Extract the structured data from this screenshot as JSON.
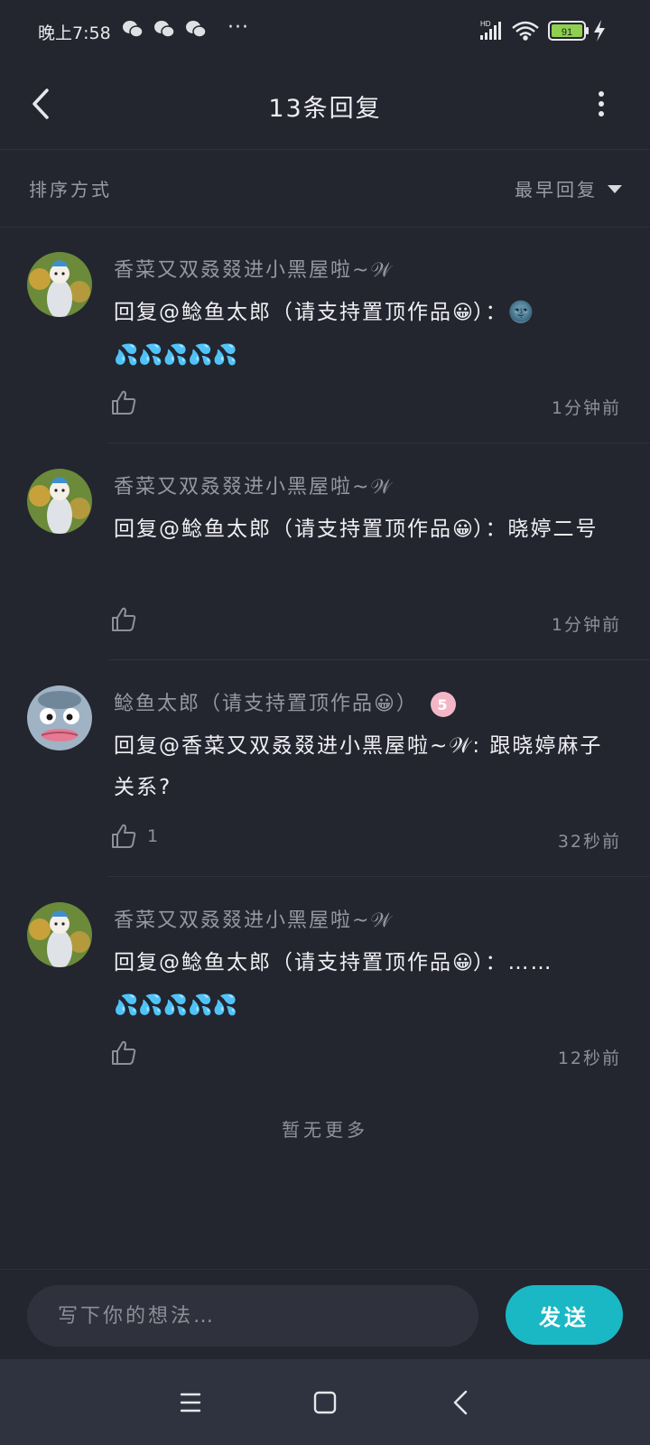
{
  "status_bar": {
    "time": "晚上7:58",
    "dots": "···",
    "network": "HD",
    "battery": "91",
    "icons": [
      "wechat-icon",
      "wechat-icon",
      "wechat-icon",
      "signal-icon",
      "wifi-icon",
      "battery-icon",
      "charging-icon"
    ]
  },
  "header": {
    "title": "13条回复",
    "icons": [
      "back-arrow-icon",
      "more-vertical-icon"
    ]
  },
  "sort": {
    "label": "排序方式",
    "selected": "最早回复",
    "icon": "caret-down-icon"
  },
  "comments": [
    {
      "user": "香菜又双叒叕进小黑屋啦~𝒲",
      "prefix": "回复@鲶鱼太郎（请支持置顶作品",
      "emoji": "😀",
      "suffix": "）：🌚",
      "extra": "💦💦💦💦💦",
      "likes": "",
      "time": "1分钟前"
    },
    {
      "user": "香菜又双叒叕进小黑屋啦~𝒲",
      "prefix": "回复@鲶鱼太郎（请支持置顶作品",
      "emoji": "😀",
      "suffix": "）：晓婷二号",
      "extra": "",
      "likes": "",
      "time": "1分钟前"
    },
    {
      "user": "鲶鱼太郎（请支持置顶作品😀）",
      "badge": "5",
      "prefix": "回复@香菜又双叒叕进小黑屋啦~𝒲: 跟晓婷麻子关系?",
      "emoji": "",
      "suffix": "",
      "extra": "",
      "likes": "1",
      "time": "32秒前"
    },
    {
      "user": "香菜又双叒叕进小黑屋啦~𝒲",
      "prefix": "回复@鲶鱼太郎（请支持置顶作品",
      "emoji": "😀",
      "suffix": "）：……",
      "extra": "💦💦💦💦💦",
      "likes": "",
      "time": "12秒前"
    }
  ],
  "footer_note": "暂无更多",
  "input": {
    "placeholder": "写下你的想法…",
    "send_label": "发送"
  },
  "nav": {
    "icons": [
      "menu-icon",
      "home-square-icon",
      "back-chevron-icon"
    ]
  },
  "colors": {
    "background": "#23252f",
    "accent": "#1ab8c4",
    "muted_text": "#9698a1"
  }
}
